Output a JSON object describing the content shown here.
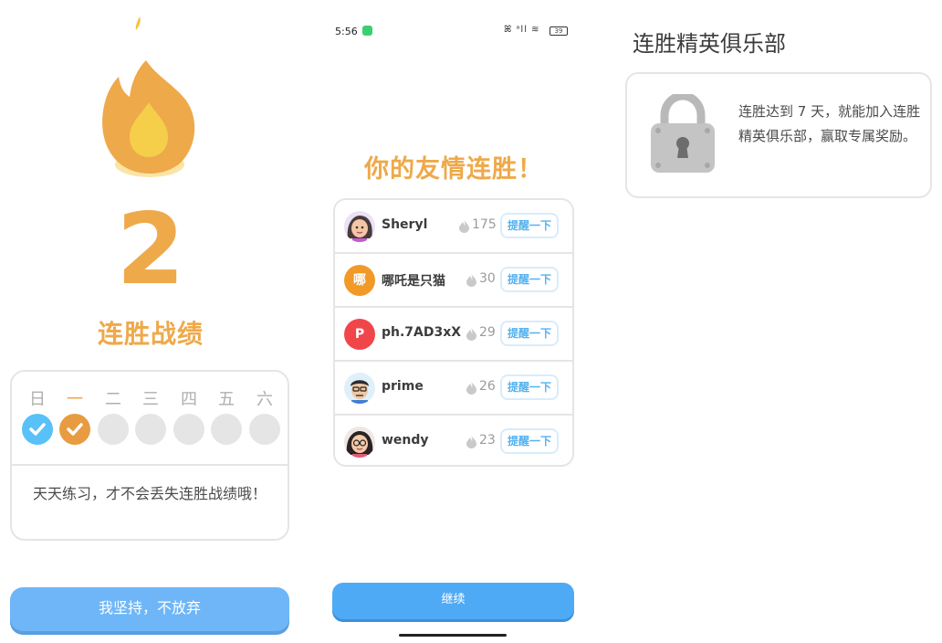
{
  "streak_screen": {
    "streak_count": "2",
    "title": "连胜战绩",
    "weekdays": [
      "日",
      "一",
      "二",
      "三",
      "四",
      "五",
      "六"
    ],
    "message": "天天练习，才不会丢失连胜战绩哦！",
    "button_label": "我坚持，不放弃"
  },
  "friends_screen": {
    "status": {
      "time": "5:56",
      "signal": "ꕤ ᵃll ≋",
      "battery": "39"
    },
    "title": "你的友情连胜！",
    "nudge_label": "提醒一下",
    "friends": [
      {
        "name": "Sheryl",
        "score": "175",
        "avatar_letter": ""
      },
      {
        "name": "哪吒是只猫",
        "score": "30",
        "avatar_letter": "哪"
      },
      {
        "name": "ph.7AD3xX",
        "score": "29",
        "avatar_letter": "P"
      },
      {
        "name": "prime",
        "score": "26",
        "avatar_letter": ""
      },
      {
        "name": "wendy",
        "score": "23",
        "avatar_letter": ""
      }
    ],
    "continue_label": "继续"
  },
  "club_screen": {
    "title": "连胜精英俱乐部",
    "description": "连胜达到 7 天，就能加入连胜精英俱乐部，赢取专属奖励。"
  },
  "colors": {
    "streak_orange": "#eea94a",
    "primary_blue": "#4faaf6",
    "border_gray": "#e5e5e5"
  }
}
